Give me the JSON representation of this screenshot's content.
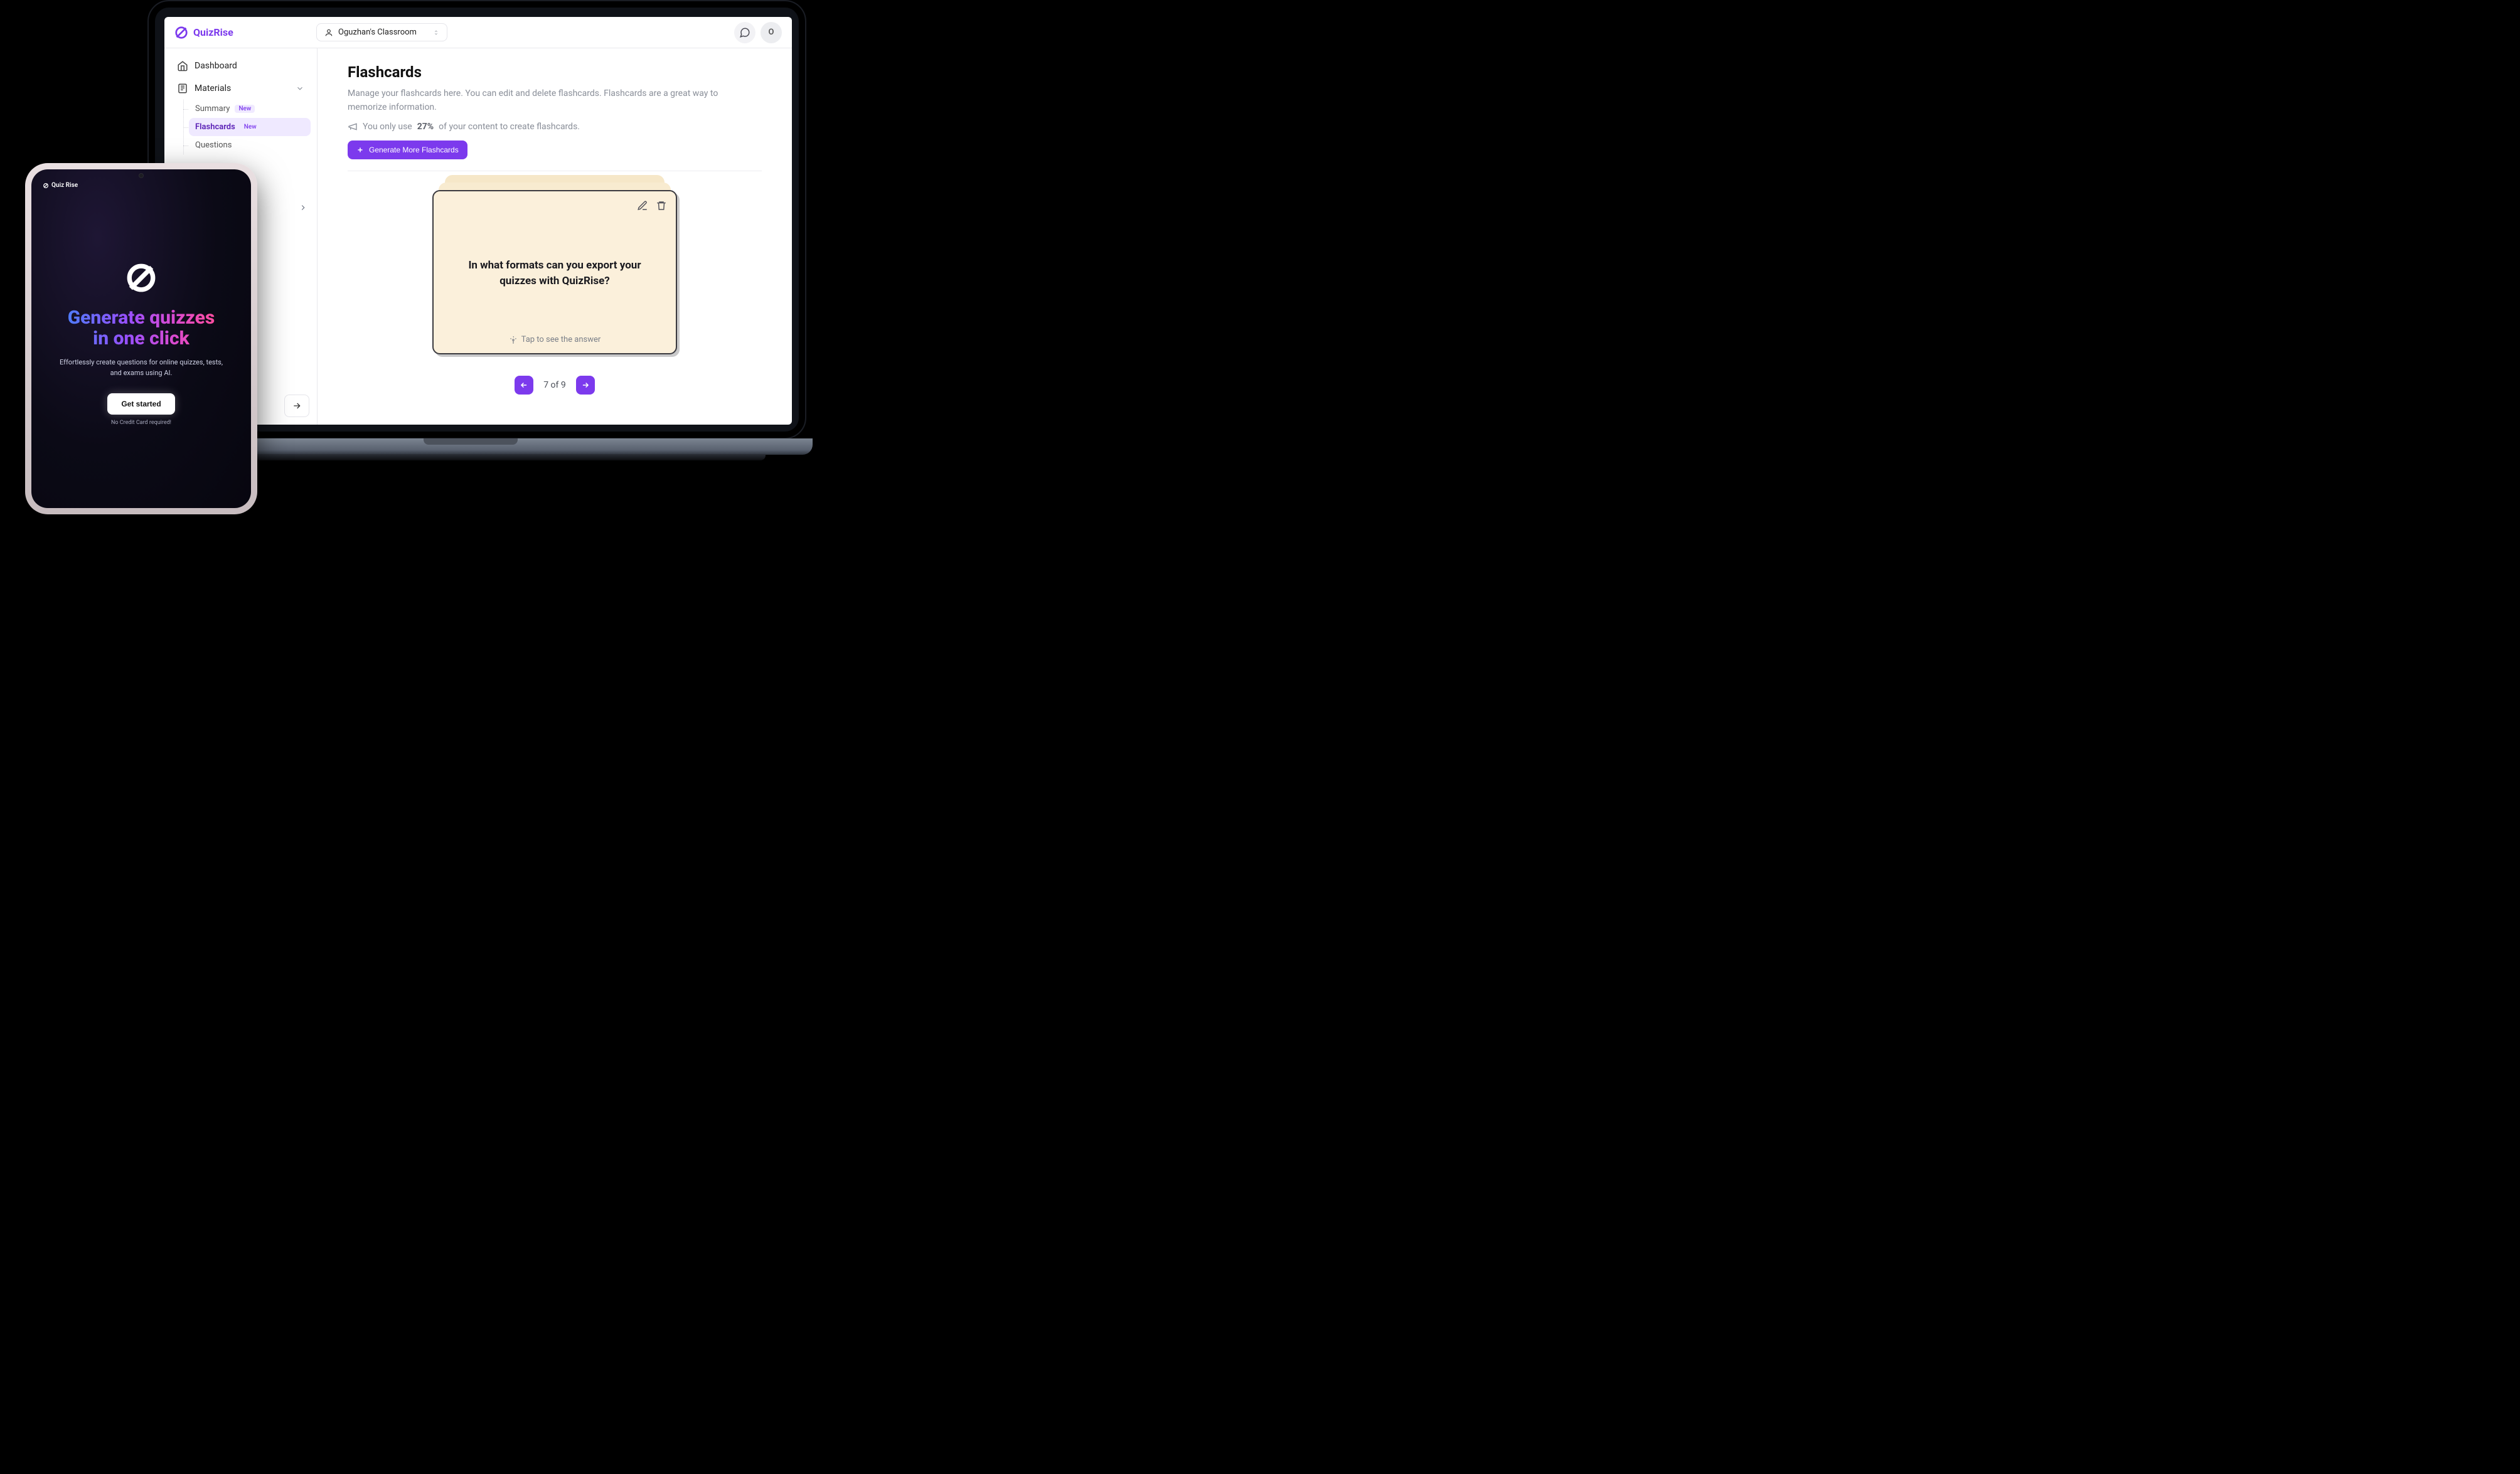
{
  "brand": "QuizRise",
  "classroom_label": "Oguzhan's Classroom",
  "avatar_initial": "O",
  "sidebar": {
    "dashboard": "Dashboard",
    "materials": "Materials",
    "sub": {
      "summary": "Summary",
      "flashcards": "Flashcards",
      "questions": "Questions"
    },
    "new_badge": "New"
  },
  "page": {
    "title": "Flashcards",
    "description": "Manage your flashcards here. You can edit and delete flashcards. Flashcards are a great way to memorize information.",
    "usage_prefix": "You only use ",
    "usage_percent": "27%",
    "usage_suffix": " of your content to create flashcards.",
    "generate_button": "Generate More Flashcards"
  },
  "card": {
    "question": "In what formats can you export your quizzes with QuizRise?",
    "tap_hint": "Tap to see the answer"
  },
  "pager": {
    "text": "7 of 9"
  },
  "tablet": {
    "brand": "Quiz Rise",
    "headline_line1": "Generate quizzes",
    "headline_line2": "in one click",
    "subtitle": "Effortlessly create questions for online quizzes, tests, and exams using AI.",
    "cta": "Get started",
    "footnote": "No Credit Card required!"
  }
}
